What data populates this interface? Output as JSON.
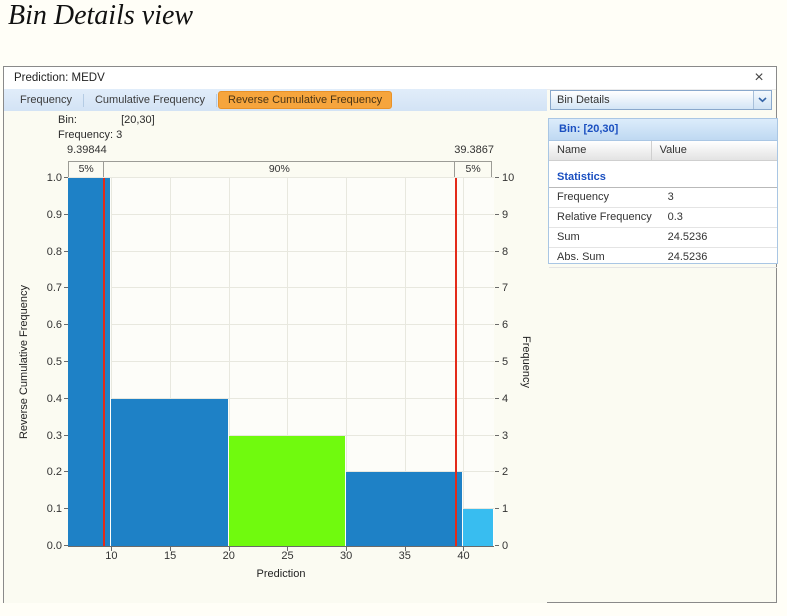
{
  "page": {
    "title": "Bin Details view"
  },
  "window": {
    "title": "Prediction: MEDV",
    "close_icon": "×",
    "tabs": [
      {
        "label": "Frequency",
        "active": false
      },
      {
        "label": "Cumulative Frequency",
        "active": false
      },
      {
        "label": "Reverse Cumulative Frequency",
        "active": true
      }
    ],
    "active_tab_color": "#f6a53d",
    "details_dropdown": {
      "value": "Bin Details"
    }
  },
  "chart_info": {
    "bin_label": "Bin:",
    "bin_value": "[20,30]",
    "frequency_label": "Frequency:",
    "frequency_value": "3"
  },
  "chart_data": {
    "type": "bar",
    "title": "",
    "xlabel": "Prediction",
    "ylabel_left": "Reverse Cumulative Frequency",
    "ylabel_right": "Frequency",
    "x_range": [
      6.3,
      42.6
    ],
    "x_ticks": [
      10,
      15,
      20,
      25,
      30,
      35,
      40
    ],
    "y_left_ticks": [
      "0.0",
      "0.1",
      "0.2",
      "0.3",
      "0.4",
      "0.5",
      "0.6",
      "0.7",
      "0.8",
      "0.9",
      "1.0"
    ],
    "y_left_range": [
      0,
      1
    ],
    "y_right_ticks": [
      0,
      1,
      2,
      3,
      4,
      5,
      6,
      7,
      8,
      9,
      10
    ],
    "y_right_range": [
      0,
      10
    ],
    "grid": true,
    "bins": [
      {
        "x0": 6.3,
        "x1": 10,
        "value": 1.0,
        "frequency": 10,
        "color": "#1e81c6",
        "selected": false
      },
      {
        "x0": 10,
        "x1": 20,
        "value": 0.4,
        "frequency": 4,
        "color": "#1e81c6",
        "selected": false
      },
      {
        "x0": 20,
        "x1": 30,
        "value": 0.3,
        "frequency": 3,
        "color": "#70fa0e",
        "selected": true
      },
      {
        "x0": 30,
        "x1": 40,
        "value": 0.2,
        "frequency": 2,
        "color": "#1e81c6",
        "selected": false
      },
      {
        "x0": 40,
        "x1": 42.6,
        "value": 0.1,
        "frequency": 1,
        "color": "#38bdf0",
        "selected": false
      }
    ],
    "percentile_markers": [
      {
        "value": 9.39844,
        "label": "9.39844"
      },
      {
        "value": 39.3867,
        "label": "39.3867"
      }
    ],
    "percentile_bands": [
      "5%",
      "90%",
      "5%"
    ],
    "marker_color": "#e32b1a"
  },
  "details_panel": {
    "header": "Bin: [20,30]",
    "columns": [
      "Name",
      "Value"
    ],
    "section": "Statistics",
    "rows": [
      {
        "name": "Frequency",
        "value": "3"
      },
      {
        "name": "Relative Frequency",
        "value": "0.3"
      },
      {
        "name": "Sum",
        "value": "24.5236"
      },
      {
        "name": "Abs. Sum",
        "value": "24.5236"
      }
    ]
  }
}
